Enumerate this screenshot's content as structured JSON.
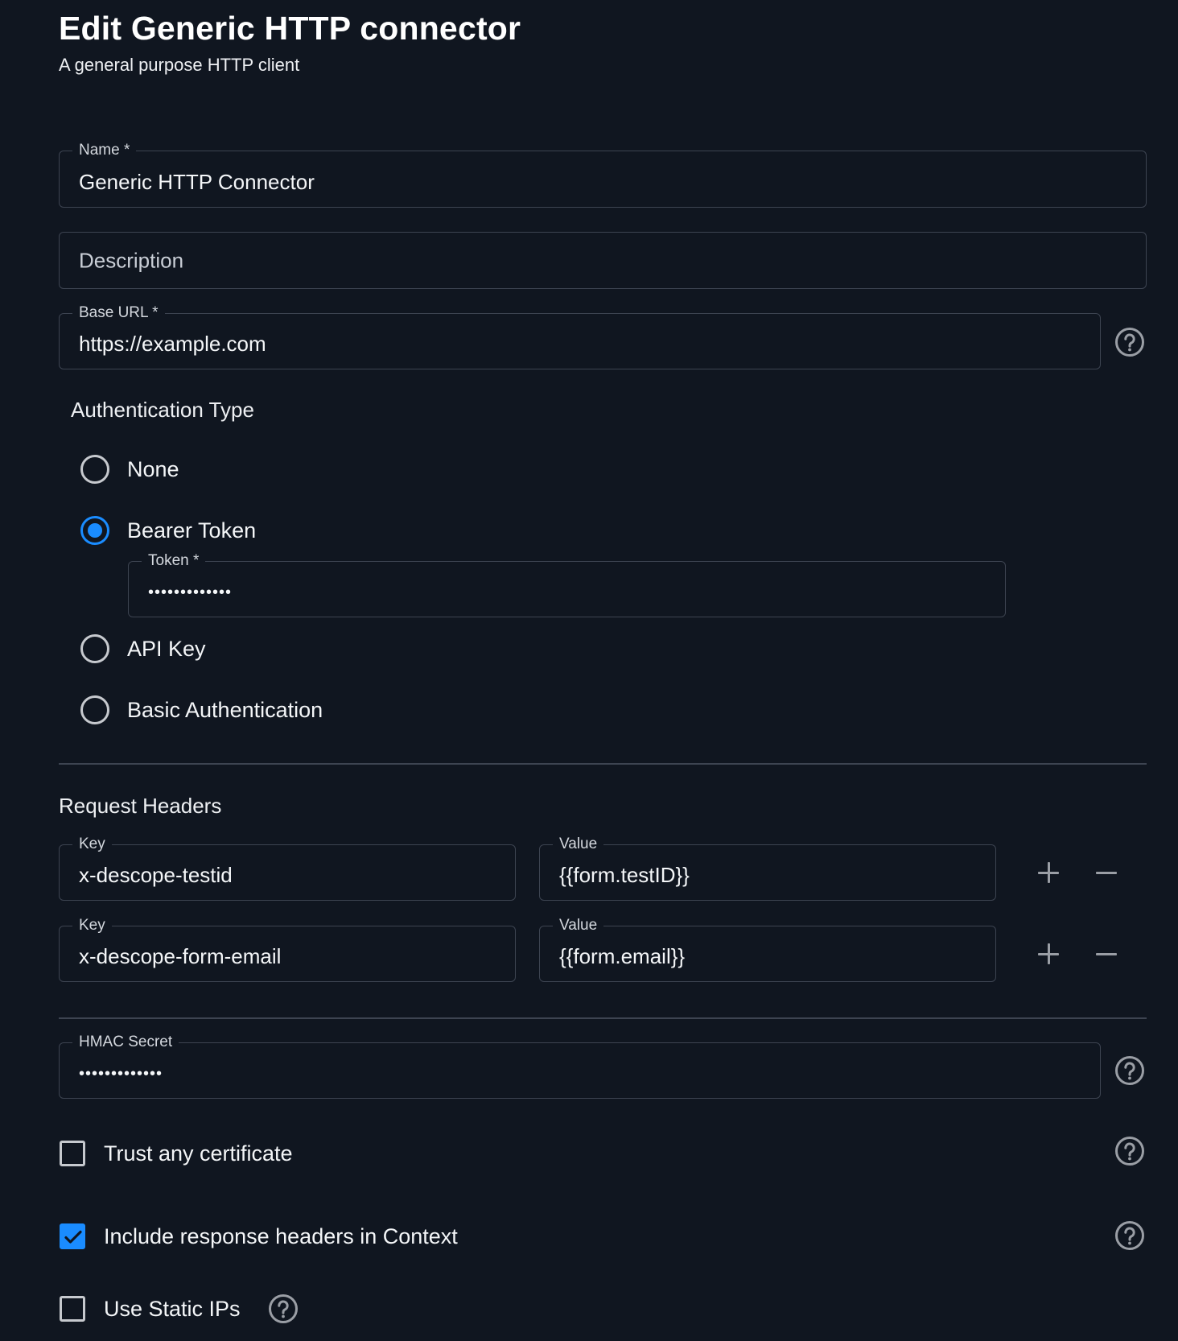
{
  "header": {
    "title": "Edit Generic HTTP connector",
    "subtitle": "A general purpose HTTP client"
  },
  "fields": {
    "name": {
      "label": "Name *",
      "value": "Generic HTTP Connector"
    },
    "description": {
      "placeholder": "Description",
      "value": ""
    },
    "base_url": {
      "label": "Base URL *",
      "value": "https://example.com"
    }
  },
  "auth": {
    "title": "Authentication Type",
    "selected": "Bearer Token",
    "options": [
      {
        "label": "None",
        "checked": false
      },
      {
        "label": "Bearer Token",
        "checked": true
      },
      {
        "label": "API Key",
        "checked": false
      },
      {
        "label": "Basic Authentication",
        "checked": false
      }
    ],
    "token": {
      "label": "Token *",
      "value": "•••••••••••••"
    }
  },
  "request_headers": {
    "title": "Request Headers",
    "rows": [
      {
        "key_label": "Key",
        "key": "x-descope-testid",
        "value_label": "Value",
        "value": "{{form.testID}}"
      },
      {
        "key_label": "Key",
        "key": "x-descope-form-email",
        "value_label": "Value",
        "value": "{{form.email}}"
      }
    ]
  },
  "hmac": {
    "label": "HMAC Secret",
    "value": "•••••••••••••"
  },
  "options": {
    "trust_cert": {
      "label": "Trust any certificate",
      "checked": false
    },
    "include_headers": {
      "label": "Include response headers in Context",
      "checked": true
    },
    "static_ips": {
      "label": "Use Static IPs",
      "checked": false
    }
  },
  "colors": {
    "background": "#101620",
    "accent": "#1a8cff",
    "border": "#3d4451",
    "icon": "#9a9ea5"
  }
}
